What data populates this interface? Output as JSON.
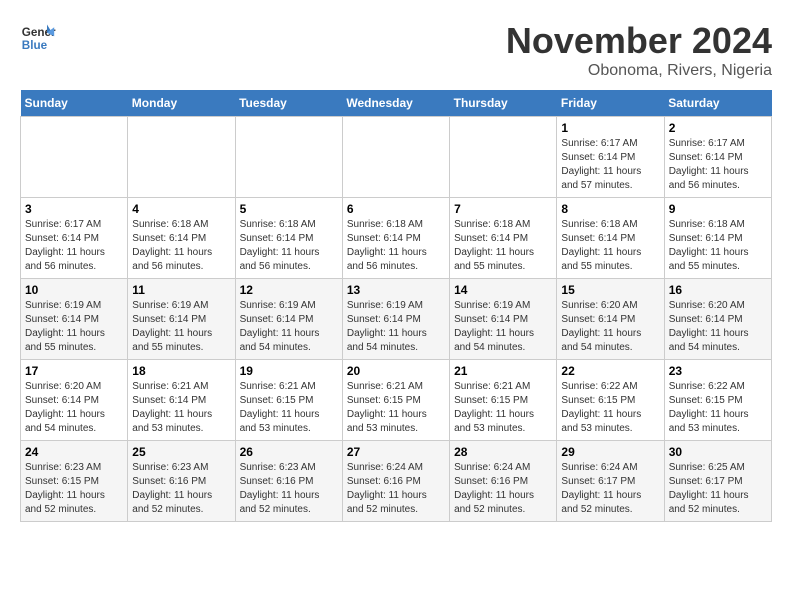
{
  "header": {
    "logo": {
      "line1": "General",
      "line2": "Blue"
    },
    "title": "November 2024",
    "subtitle": "Obonoma, Rivers, Nigeria"
  },
  "days_of_week": [
    "Sunday",
    "Monday",
    "Tuesday",
    "Wednesday",
    "Thursday",
    "Friday",
    "Saturday"
  ],
  "weeks": [
    [
      {
        "day": "",
        "info": ""
      },
      {
        "day": "",
        "info": ""
      },
      {
        "day": "",
        "info": ""
      },
      {
        "day": "",
        "info": ""
      },
      {
        "day": "",
        "info": ""
      },
      {
        "day": "1",
        "info": "Sunrise: 6:17 AM\nSunset: 6:14 PM\nDaylight: 11 hours and 57 minutes."
      },
      {
        "day": "2",
        "info": "Sunrise: 6:17 AM\nSunset: 6:14 PM\nDaylight: 11 hours and 56 minutes."
      }
    ],
    [
      {
        "day": "3",
        "info": "Sunrise: 6:17 AM\nSunset: 6:14 PM\nDaylight: 11 hours and 56 minutes."
      },
      {
        "day": "4",
        "info": "Sunrise: 6:18 AM\nSunset: 6:14 PM\nDaylight: 11 hours and 56 minutes."
      },
      {
        "day": "5",
        "info": "Sunrise: 6:18 AM\nSunset: 6:14 PM\nDaylight: 11 hours and 56 minutes."
      },
      {
        "day": "6",
        "info": "Sunrise: 6:18 AM\nSunset: 6:14 PM\nDaylight: 11 hours and 56 minutes."
      },
      {
        "day": "7",
        "info": "Sunrise: 6:18 AM\nSunset: 6:14 PM\nDaylight: 11 hours and 55 minutes."
      },
      {
        "day": "8",
        "info": "Sunrise: 6:18 AM\nSunset: 6:14 PM\nDaylight: 11 hours and 55 minutes."
      },
      {
        "day": "9",
        "info": "Sunrise: 6:18 AM\nSunset: 6:14 PM\nDaylight: 11 hours and 55 minutes."
      }
    ],
    [
      {
        "day": "10",
        "info": "Sunrise: 6:19 AM\nSunset: 6:14 PM\nDaylight: 11 hours and 55 minutes."
      },
      {
        "day": "11",
        "info": "Sunrise: 6:19 AM\nSunset: 6:14 PM\nDaylight: 11 hours and 55 minutes."
      },
      {
        "day": "12",
        "info": "Sunrise: 6:19 AM\nSunset: 6:14 PM\nDaylight: 11 hours and 54 minutes."
      },
      {
        "day": "13",
        "info": "Sunrise: 6:19 AM\nSunset: 6:14 PM\nDaylight: 11 hours and 54 minutes."
      },
      {
        "day": "14",
        "info": "Sunrise: 6:19 AM\nSunset: 6:14 PM\nDaylight: 11 hours and 54 minutes."
      },
      {
        "day": "15",
        "info": "Sunrise: 6:20 AM\nSunset: 6:14 PM\nDaylight: 11 hours and 54 minutes."
      },
      {
        "day": "16",
        "info": "Sunrise: 6:20 AM\nSunset: 6:14 PM\nDaylight: 11 hours and 54 minutes."
      }
    ],
    [
      {
        "day": "17",
        "info": "Sunrise: 6:20 AM\nSunset: 6:14 PM\nDaylight: 11 hours and 54 minutes."
      },
      {
        "day": "18",
        "info": "Sunrise: 6:21 AM\nSunset: 6:14 PM\nDaylight: 11 hours and 53 minutes."
      },
      {
        "day": "19",
        "info": "Sunrise: 6:21 AM\nSunset: 6:15 PM\nDaylight: 11 hours and 53 minutes."
      },
      {
        "day": "20",
        "info": "Sunrise: 6:21 AM\nSunset: 6:15 PM\nDaylight: 11 hours and 53 minutes."
      },
      {
        "day": "21",
        "info": "Sunrise: 6:21 AM\nSunset: 6:15 PM\nDaylight: 11 hours and 53 minutes."
      },
      {
        "day": "22",
        "info": "Sunrise: 6:22 AM\nSunset: 6:15 PM\nDaylight: 11 hours and 53 minutes."
      },
      {
        "day": "23",
        "info": "Sunrise: 6:22 AM\nSunset: 6:15 PM\nDaylight: 11 hours and 53 minutes."
      }
    ],
    [
      {
        "day": "24",
        "info": "Sunrise: 6:23 AM\nSunset: 6:15 PM\nDaylight: 11 hours and 52 minutes."
      },
      {
        "day": "25",
        "info": "Sunrise: 6:23 AM\nSunset: 6:16 PM\nDaylight: 11 hours and 52 minutes."
      },
      {
        "day": "26",
        "info": "Sunrise: 6:23 AM\nSunset: 6:16 PM\nDaylight: 11 hours and 52 minutes."
      },
      {
        "day": "27",
        "info": "Sunrise: 6:24 AM\nSunset: 6:16 PM\nDaylight: 11 hours and 52 minutes."
      },
      {
        "day": "28",
        "info": "Sunrise: 6:24 AM\nSunset: 6:16 PM\nDaylight: 11 hours and 52 minutes."
      },
      {
        "day": "29",
        "info": "Sunrise: 6:24 AM\nSunset: 6:17 PM\nDaylight: 11 hours and 52 minutes."
      },
      {
        "day": "30",
        "info": "Sunrise: 6:25 AM\nSunset: 6:17 PM\nDaylight: 11 hours and 52 minutes."
      }
    ]
  ]
}
